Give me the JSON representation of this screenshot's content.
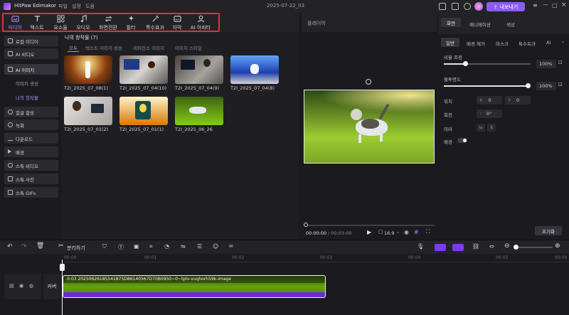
{
  "app": {
    "name": "HitPaw Edimakor",
    "project_title": "2025-07-22_03",
    "export_label": "내보내기"
  },
  "menu": [
    "파일",
    "설정",
    "도움"
  ],
  "toolbar": [
    {
      "label": "미디어",
      "icon": "media-icon"
    },
    {
      "label": "텍스트",
      "icon": "text-icon"
    },
    {
      "label": "요소들",
      "icon": "elements-icon"
    },
    {
      "label": "오디오",
      "icon": "audio-icon"
    },
    {
      "label": "화면전환",
      "icon": "transition-icon"
    },
    {
      "label": "필터",
      "icon": "filter-icon"
    },
    {
      "label": "특수효과",
      "icon": "effects-icon"
    },
    {
      "label": "자막",
      "icon": "subtitle-icon"
    },
    {
      "label": "AI 아바타",
      "icon": "ai-avatar-icon"
    }
  ],
  "sidebar": [
    {
      "label": "로컬 미디어"
    },
    {
      "label": "AI 비디오"
    },
    {
      "label": "AI 이미지"
    },
    {
      "label": "이미지 생성"
    },
    {
      "label": "나의 창작물"
    },
    {
      "label": "얼굴 합성"
    },
    {
      "label": "녹화"
    },
    {
      "label": "다운로드"
    },
    {
      "label": "배경"
    },
    {
      "label": "스톡 비디오"
    },
    {
      "label": "스톡 사진"
    },
    {
      "label": "스톡 GIFs"
    }
  ],
  "media": {
    "heading": "나의 창작물 (7)",
    "tabs": [
      "모두",
      "텍스트 이미지 생성",
      "레퍼런스 이미지",
      "이미지 스타일"
    ],
    "items": [
      {
        "label": "T2I_2025_07_08(1)"
      },
      {
        "label": "T2I_2025_07_04(10)"
      },
      {
        "label": "T2I_2025_07_04(9)"
      },
      {
        "label": "T2I_2025_07_04(8)"
      },
      {
        "label": "T2I_2025_07_01(2)"
      },
      {
        "label": "T2I_2025_07_01(1)"
      },
      {
        "label": "T2I_2025_06_26"
      }
    ]
  },
  "player": {
    "title": "플레이어",
    "time": "00:00:00",
    "duration": "/ 00:03:00",
    "ratio": "16:9"
  },
  "props": {
    "tabs": [
      "화면",
      "애니메이션",
      "색상"
    ],
    "subtabs": [
      "일반",
      "배경 제거",
      "마스크",
      "특수효과",
      "AI"
    ],
    "scale_label": "비율 조정",
    "scale_value": "100%",
    "opacity_label": "불투명도",
    "opacity_value": "100%",
    "position_label": "위치",
    "x_label": "X",
    "x_value": "0",
    "y_label": "Y",
    "y_value": "0",
    "rotate_label": "회전",
    "rotate_value": "0°",
    "mirror_label": "미러",
    "bg_label": "배경",
    "reset_label": "초기화"
  },
  "timeline": {
    "split_label": "분리하기",
    "ruler": [
      "00:00",
      "00:01",
      "00:02",
      "00:03",
      "00:04",
      "00:05",
      "00:06"
    ],
    "cover_label": "커버",
    "clip_label": "0:03  20250626185541875D86140567D70B0950~0~tplv-vuqhorh59k-image"
  },
  "colors": {
    "accent": "#8b5cf6",
    "highlight": "#e0313c"
  }
}
